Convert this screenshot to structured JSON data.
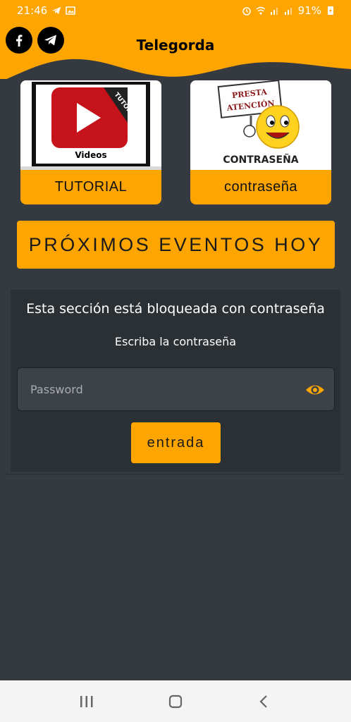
{
  "status_bar": {
    "time": "21:46",
    "battery": "91%"
  },
  "header": {
    "title": "Telegorda",
    "social": [
      "facebook-icon",
      "telegram-icon"
    ],
    "accent": "#ffa500"
  },
  "cards": [
    {
      "label": "TUTORIAL",
      "thumb_badge": "TUTORIAL",
      "thumb_caption": "Videos"
    },
    {
      "label": "contraseña",
      "thumb_sign_line1": "PRESTA",
      "thumb_sign_line2": "ATENCIÓN",
      "thumb_caption": "CONTRASEÑA"
    }
  ],
  "events_button": "PRÓXIMOS EVENTOS HOY",
  "locked": {
    "title": "Esta sección está bloqueada con contraseña",
    "subtitle": "Escriba la contraseña",
    "password_placeholder": "Password",
    "password_value": "",
    "submit_label": "entrada"
  },
  "colors": {
    "background": "#343a40",
    "panel": "#2b3035",
    "accent": "#ffa500"
  }
}
